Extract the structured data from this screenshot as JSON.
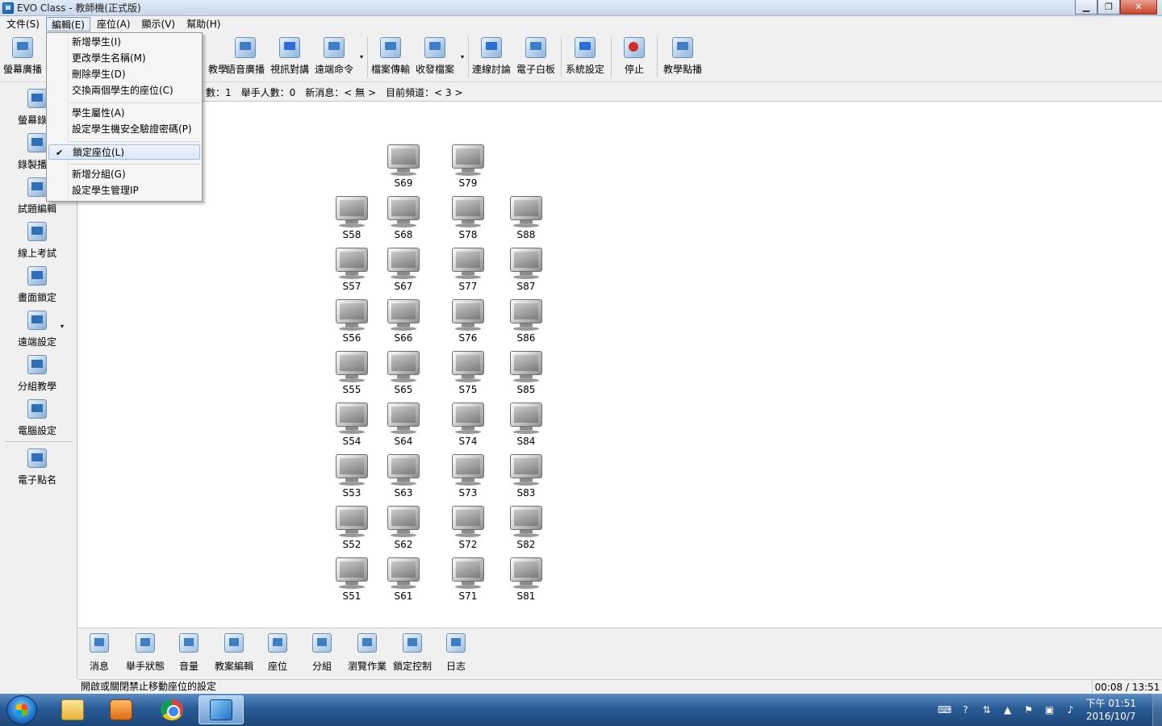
{
  "window": {
    "title": "EVO Class - 教師機(正式版)",
    "controls": {
      "minimize": "▁",
      "maximize": "❐",
      "close": "✕"
    }
  },
  "menubar": {
    "items": [
      "文件(S)",
      "編輯(E)",
      "座位(A)",
      "顯示(V)",
      "幫助(H)"
    ],
    "active": "編輯(E)"
  },
  "toolbar": {
    "items": [
      {
        "label": "螢幕廣播",
        "icon": "screen-broadcast-icon"
      },
      {
        "label": "教學",
        "icon": "teaching-icon"
      },
      {
        "label": "語音廣播",
        "icon": "voice-broadcast-icon"
      },
      {
        "label": "視訊對講",
        "icon": "video-talk-icon"
      },
      {
        "label": "遠端命令",
        "icon": "remote-command-icon"
      },
      {
        "label": "檔案傳輸",
        "icon": "file-transfer-icon"
      },
      {
        "label": "收發檔案",
        "icon": "send-receive-file-icon"
      },
      {
        "label": "連線討論",
        "icon": "online-discussion-icon"
      },
      {
        "label": "電子白板",
        "icon": "whiteboard-icon"
      },
      {
        "label": "系統設定",
        "icon": "system-settings-icon"
      },
      {
        "label": "停止",
        "icon": "stop-icon"
      },
      {
        "label": "教學點播",
        "icon": "vod-icon"
      }
    ]
  },
  "infobar": {
    "count_label": "數：1",
    "hands_label": "舉手人數：0",
    "news_label": "新消息：< 無 >",
    "channel_label": "目前頻道：< 3 >"
  },
  "sidebar": {
    "items": [
      {
        "label": "螢幕錄製",
        "icon": "screen-record-icon"
      },
      {
        "label": "錄製播放",
        "icon": "record-playback-icon"
      },
      {
        "label": "試題編輯",
        "icon": "quiz-edit-icon"
      },
      {
        "label": "線上考試",
        "icon": "online-exam-icon"
      },
      {
        "label": "畫面鎖定",
        "icon": "screen-lock-icon"
      },
      {
        "label": "遠端設定",
        "icon": "remote-settings-icon"
      },
      {
        "label": "分組教學",
        "icon": "group-teaching-icon"
      },
      {
        "label": "電腦設定",
        "icon": "computer-settings-icon"
      },
      {
        "label": "電子點名",
        "icon": "roll-call-icon"
      }
    ]
  },
  "edit_menu": {
    "items": [
      {
        "label": "新增學生(I)",
        "checked": false
      },
      {
        "label": "更改學生名稱(M)",
        "checked": false
      },
      {
        "label": "刪除學生(D)",
        "checked": false
      },
      {
        "label": "交換兩個學生的座位(C)",
        "checked": false
      },
      {
        "label": "學生屬性(A)",
        "checked": false
      },
      {
        "label": "設定學生機安全驗證密碼(P)",
        "checked": false
      },
      {
        "label": "鎖定座位(L)",
        "checked": true
      },
      {
        "label": "新增分組(G)",
        "checked": false
      },
      {
        "label": "設定學生管理IP",
        "checked": false
      }
    ],
    "check_glyph": "✔"
  },
  "seats": {
    "col_1": [
      "S58",
      "S57",
      "S56",
      "S55",
      "S54",
      "S53",
      "S52",
      "S51"
    ],
    "col_2": [
      "S69",
      "S68",
      "S67",
      "S66",
      "S65",
      "S64",
      "S63",
      "S62",
      "S61"
    ],
    "col_3": [
      "S79",
      "S78",
      "S77",
      "S76",
      "S75",
      "S74",
      "S73",
      "S72",
      "S71"
    ],
    "col_4": [
      "S88",
      "S87",
      "S86",
      "S85",
      "S84",
      "S83",
      "S82",
      "S81"
    ]
  },
  "bottombar": {
    "items": [
      {
        "label": "消息",
        "icon": "message-icon"
      },
      {
        "label": "舉手狀態",
        "icon": "raise-hand-icon"
      },
      {
        "label": "音量",
        "icon": "volume-icon"
      },
      {
        "label": "教案編輯",
        "icon": "lesson-edit-icon"
      },
      {
        "label": "座位",
        "icon": "seat-icon"
      },
      {
        "label": "分組",
        "icon": "group-icon"
      },
      {
        "label": "瀏覽作業",
        "icon": "browse-homework-icon"
      },
      {
        "label": "鎖定控制",
        "icon": "lock-control-icon"
      },
      {
        "label": "日志",
        "icon": "log-icon"
      }
    ]
  },
  "statusbar": {
    "text": "開啟或關閉禁止移動座位的設定",
    "time": "00:08 / 13:51"
  },
  "taskbar": {
    "clock_time": "下午 01:51",
    "clock_date": "2016/10/7",
    "tray_icons": [
      "keyboard-icon",
      "help-icon",
      "network-wifi-icon",
      "show-hidden-icon",
      "flag-icon",
      "network-icon",
      "speaker-icon"
    ]
  }
}
